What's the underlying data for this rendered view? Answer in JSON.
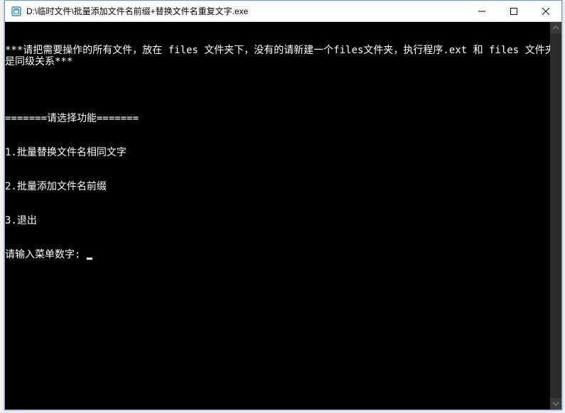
{
  "window": {
    "title": "D:\\临时文件\\批量添加文件名前缀+替换文件名重复文字.exe"
  },
  "terminal": {
    "line1": "***请把需要操作的所有文件，放在 files 文件夹下，没有的请新建一个files文件夹，执行程序.ext 和 files 文件夹是同级关系***",
    "blank": "",
    "line2": "=======请选择功能=======",
    "line3": "1.批量替换文件名相同文字",
    "line4": "2.批量添加文件名前缀",
    "line5": "3.退出",
    "line6": "请输入菜单数字: "
  }
}
